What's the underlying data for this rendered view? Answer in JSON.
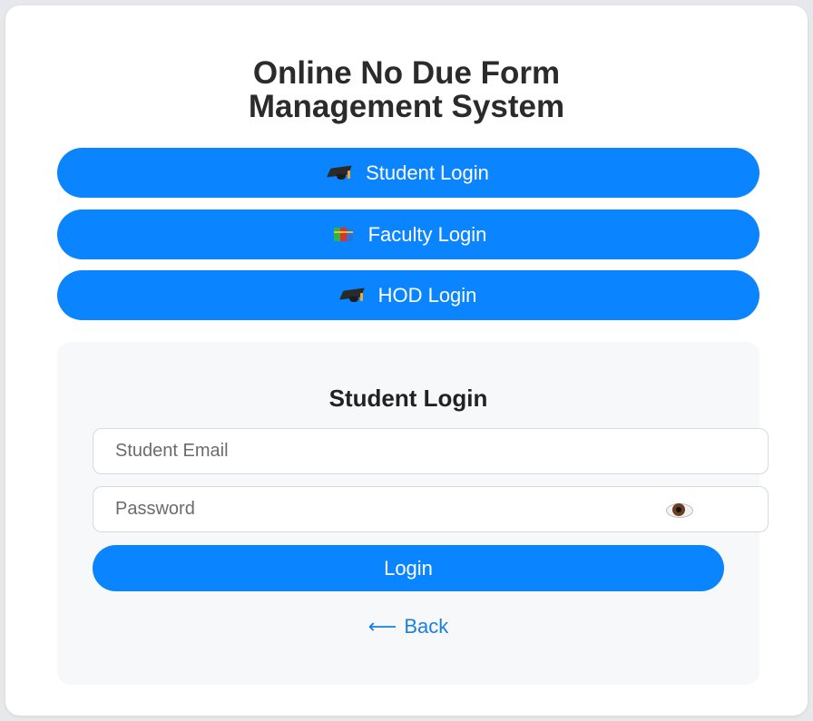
{
  "header": {
    "title_line1": "Online No Due Form",
    "title_line2": "Management System"
  },
  "roles": [
    {
      "label": "Student Login",
      "icon": "graduation-cap-icon"
    },
    {
      "label": "Faculty Login",
      "icon": "books-icon"
    },
    {
      "label": "HOD Login",
      "icon": "graduation-cap-icon"
    }
  ],
  "login_form": {
    "title": "Student Login",
    "email_placeholder": "Student Email",
    "email_value": "",
    "password_placeholder": "Password",
    "password_value": "",
    "password_toggle_icon": "eye-icon",
    "submit_label": "Login",
    "back_arrow": "⟵",
    "back_label": "Back"
  },
  "colors": {
    "primary": "#0a84ff",
    "link": "#1a7fe0",
    "panel_bg": "#f6f8fa",
    "page_bg": "#e6e8eb"
  }
}
